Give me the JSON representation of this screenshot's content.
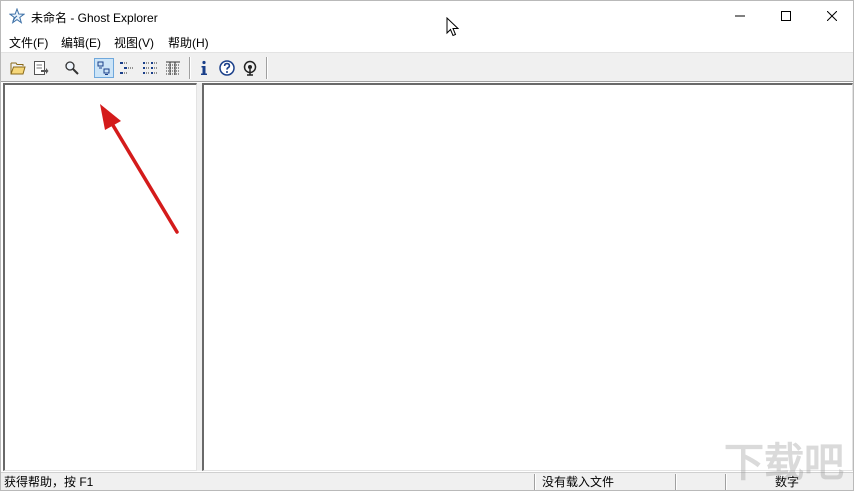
{
  "window": {
    "title": "未命名 - Ghost Explorer",
    "app_icon": "ghost-star-icon"
  },
  "window_controls": {
    "minimize_icon": "minimize-icon",
    "maximize_icon": "maximize-icon",
    "close_icon": "close-icon"
  },
  "menu": {
    "items": [
      {
        "label": "文件(F)"
      },
      {
        "label": "编辑(E)"
      },
      {
        "label": "视图(V)"
      },
      {
        "label": "帮助(H)"
      }
    ]
  },
  "toolbar": {
    "buttons": [
      {
        "icon": "open-folder-icon"
      },
      {
        "icon": "extract-icon"
      },
      {
        "icon": "find-icon"
      },
      {
        "icon": "large-icons-view-icon",
        "active": true
      },
      {
        "icon": "small-icons-view-icon"
      },
      {
        "icon": "list-view-icon"
      },
      {
        "icon": "details-view-icon"
      },
      {
        "icon": "info-icon"
      },
      {
        "icon": "help-icon"
      },
      {
        "icon": "ghost-web-icon"
      }
    ]
  },
  "statusbar": {
    "help_text": "获得帮助，按 F1",
    "file_status": "没有载入文件",
    "num_lock": "数字"
  },
  "watermark": {
    "text": "下载吧"
  },
  "colors": {
    "annotation_arrow": "#d41b1b",
    "active_button_bg": "#cce4f7",
    "toolbar_bg": "#f0f0f0"
  }
}
